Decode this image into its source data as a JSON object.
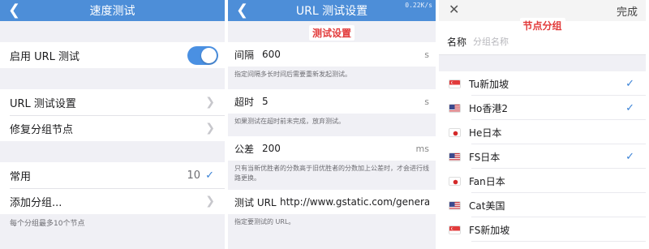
{
  "panel1": {
    "title": "速度测试",
    "back_icon": "chevron-left-icon",
    "enable_url_test_label": "启用 URL 测试",
    "url_test_settings_label": "URL 测试设置",
    "repair_group_nodes_label": "修复分组节点",
    "common_label": "常用",
    "common_count": "10",
    "add_group_label": "添加分组...",
    "footnote": "每个分组最多10个节点"
  },
  "panel2": {
    "title": "URL 测试设置",
    "speed": "0.22K/s",
    "badge": "测试设置",
    "interval": {
      "label": "间隔",
      "value": "600",
      "unit": "s",
      "desc": "指定间隔多长时间后需要重新发起测试。"
    },
    "timeout": {
      "label": "超时",
      "value": "5",
      "unit": "s",
      "desc": "如果测试在超时前未完成，放弃测试。"
    },
    "tolerance": {
      "label": "公差",
      "value": "200",
      "unit": "ms",
      "desc": "只有当新优胜者的分数高于旧优胜者的分数加上公差时，才会进行线路更换。"
    },
    "test_url": {
      "label": "测试 URL",
      "value": "http://www.gstatic.com/genera...",
      "desc": "指定要测试的 URL。"
    }
  },
  "panel3": {
    "close_icon": "close-icon",
    "done_label": "完成",
    "badge": "节点分组",
    "name_label": "名称",
    "name_placeholder": "分组名称",
    "nodes": [
      {
        "label": "Tu新加坡",
        "flag": "sg",
        "checked": true
      },
      {
        "label": "Ho香港2",
        "flag": "us",
        "checked": true
      },
      {
        "label": "He日本",
        "flag": "jp",
        "checked": false
      },
      {
        "label": "FS日本",
        "flag": "us",
        "checked": true
      },
      {
        "label": "Fan日本",
        "flag": "jp",
        "checked": false
      },
      {
        "label": "Cat美国",
        "flag": "us",
        "checked": false
      },
      {
        "label": "FS新加坡",
        "flag": "sg",
        "checked": false
      }
    ]
  },
  "colors": {
    "nav_blue": "#4d8ed8",
    "accent": "#3a82d6",
    "badge_red": "#e23b3b",
    "group_bg": "#f0f0f5"
  }
}
